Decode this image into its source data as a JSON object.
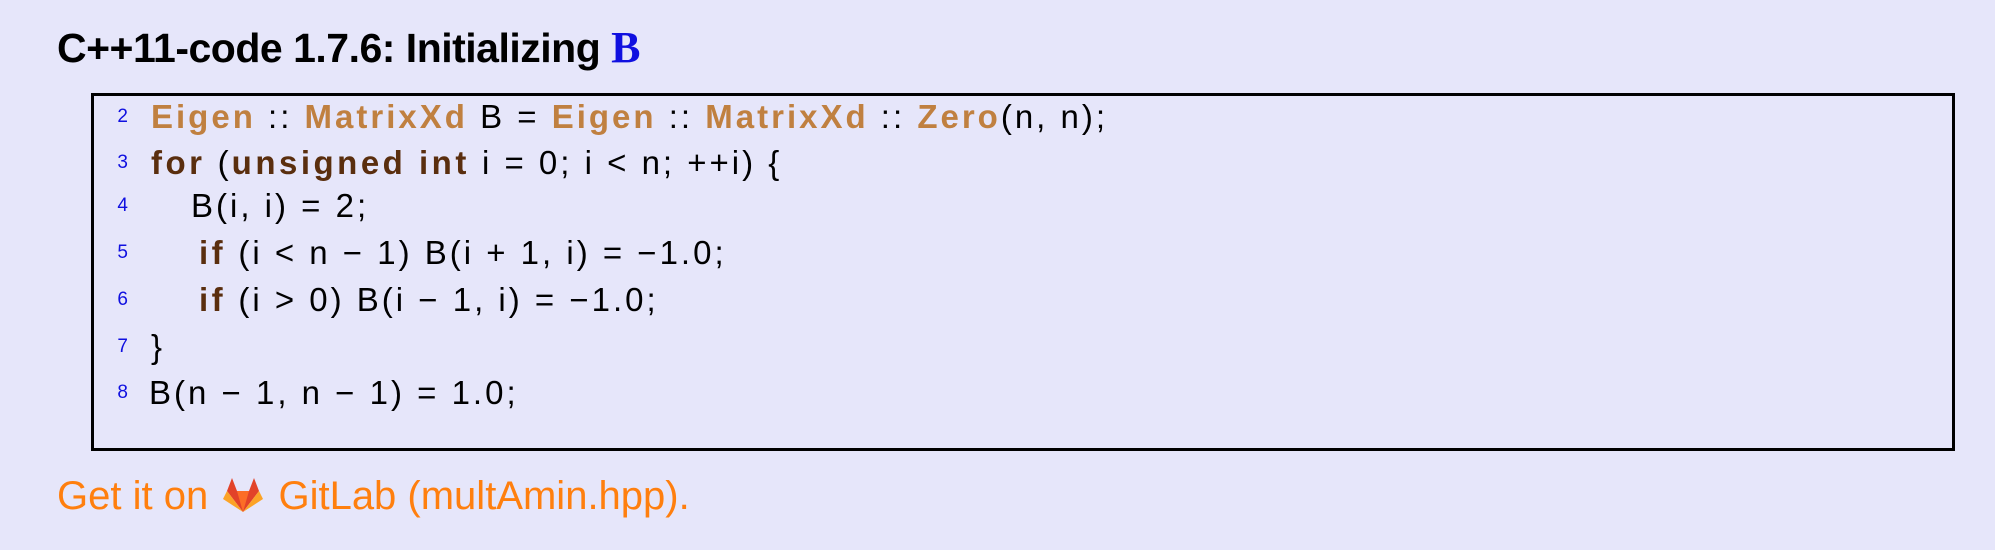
{
  "title": {
    "prefix": "C++11-code 1.7.6: Initializing ",
    "symbol": "B"
  },
  "code_lines": [
    {
      "no": "2",
      "segments": [
        {
          "t": "Eigen",
          "c": "ty"
        },
        {
          "t": " :: ",
          "c": ""
        },
        {
          "t": "MatrixXd",
          "c": "ty"
        },
        {
          "t": " B = ",
          "c": ""
        },
        {
          "t": "Eigen",
          "c": "ty"
        },
        {
          "t": " :: ",
          "c": ""
        },
        {
          "t": "MatrixXd",
          "c": "ty"
        },
        {
          "t": " :: ",
          "c": ""
        },
        {
          "t": "Zero",
          "c": "ty"
        },
        {
          "t": "(n, n);",
          "c": ""
        }
      ]
    },
    {
      "no": "3",
      "segments": [
        {
          "t": "for",
          "c": "kw"
        },
        {
          "t": " (",
          "c": ""
        },
        {
          "t": "unsigned int",
          "c": "kw"
        },
        {
          "t": " i = 0; i < n; ++i) {",
          "c": ""
        }
      ]
    },
    {
      "no": "4",
      "segments": [
        {
          "t": "B(i, i) = 2;",
          "c": ""
        }
      ]
    },
    {
      "no": "5",
      "segments": [
        {
          "t": "if",
          "c": "kw"
        },
        {
          "t": " (i < n − 1) B(i + 1, i) = −1.0;",
          "c": ""
        }
      ]
    },
    {
      "no": "6",
      "segments": [
        {
          "t": "if",
          "c": "kw"
        },
        {
          "t": " (i > 0) B(i − 1, i) = −1.0;",
          "c": ""
        }
      ]
    },
    {
      "no": "7",
      "segments": [
        {
          "t": "}",
          "c": ""
        }
      ]
    },
    {
      "no": "8",
      "segments": [
        {
          "t": "B(n − 1, n − 1) = 1.0;",
          "c": ""
        }
      ]
    }
  ],
  "footer": {
    "before": "Get it on",
    "after": "GitLab (multAmin.hpp)."
  },
  "colors": {
    "background": "#e6e6fa",
    "title_symbol": "#1010e0",
    "line_numbers": "#1010e0",
    "keyword": "#5a2e0e",
    "type": "#c08040",
    "link": "#ff7f0e"
  },
  "icons": [
    "gitlab-icon"
  ]
}
